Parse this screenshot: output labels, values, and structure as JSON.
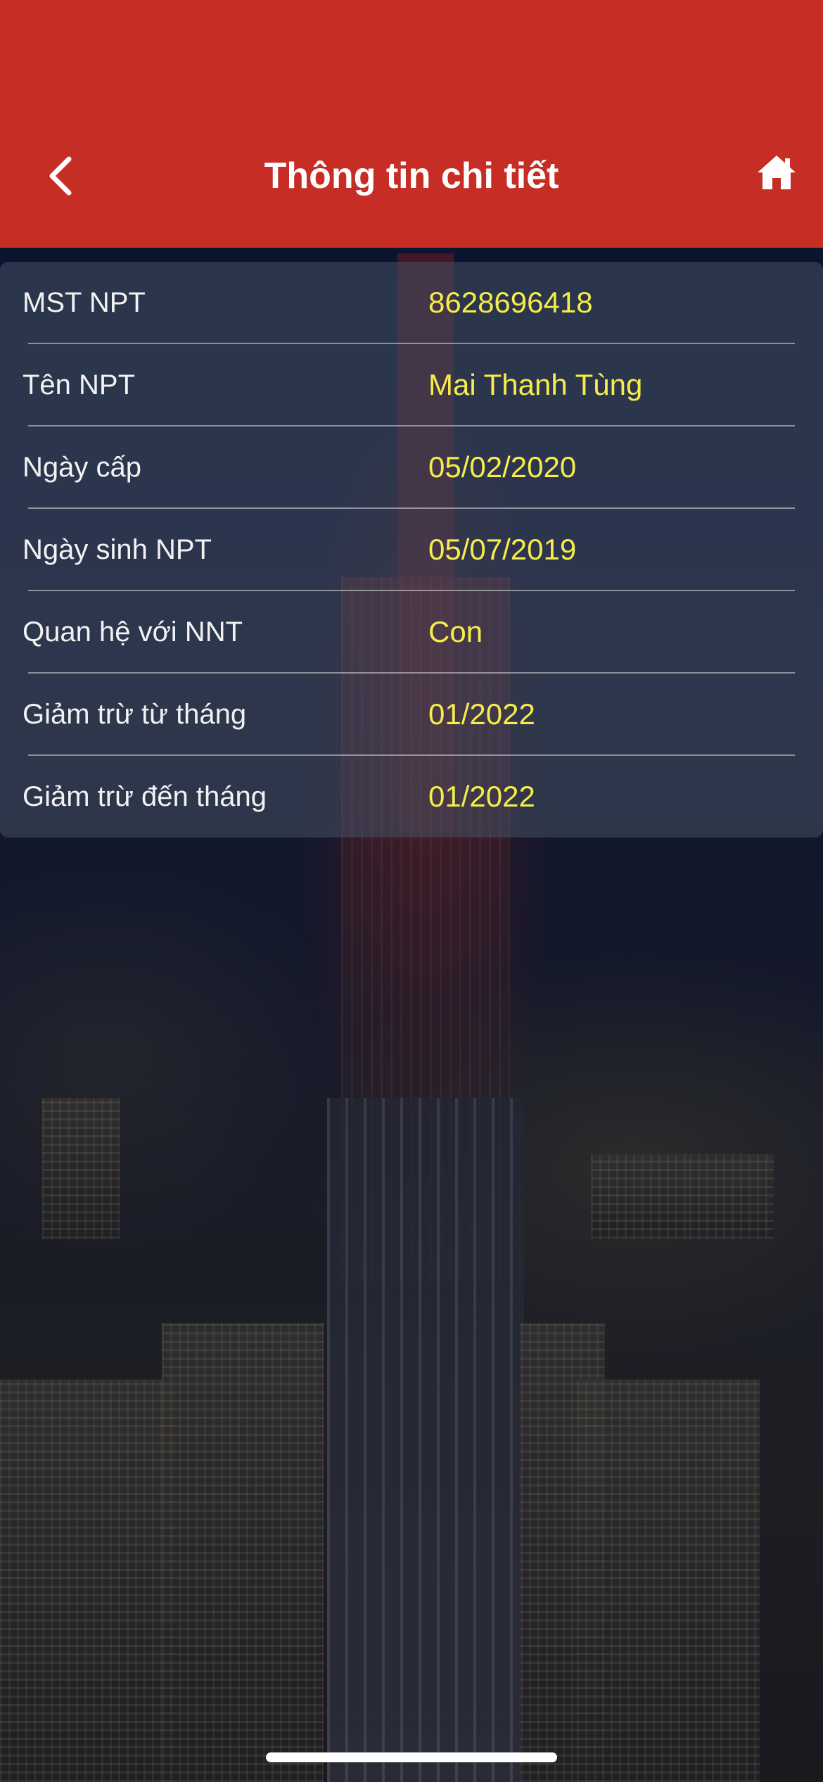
{
  "header": {
    "title": "Thông tin chi tiết",
    "back_icon": "chevron-left-icon",
    "home_icon": "home-icon",
    "background_color": "#c52d25"
  },
  "details": {
    "label_color": "#f2f2f2",
    "value_color": "#f6ec4a",
    "rows": [
      {
        "label": "MST NPT",
        "value": "8628696418"
      },
      {
        "label": "Tên NPT",
        "value": "Mai Thanh Tùng"
      },
      {
        "label": "Ngày cấp",
        "value": "05/02/2020"
      },
      {
        "label": "Ngày sinh NPT",
        "value": "05/07/2019"
      },
      {
        "label": "Quan hệ với NNT",
        "value": "Con"
      },
      {
        "label": "Giảm trừ từ tháng",
        "value": "01/2022"
      },
      {
        "label": "Giảm trừ đến tháng",
        "value": "01/2022"
      }
    ]
  }
}
